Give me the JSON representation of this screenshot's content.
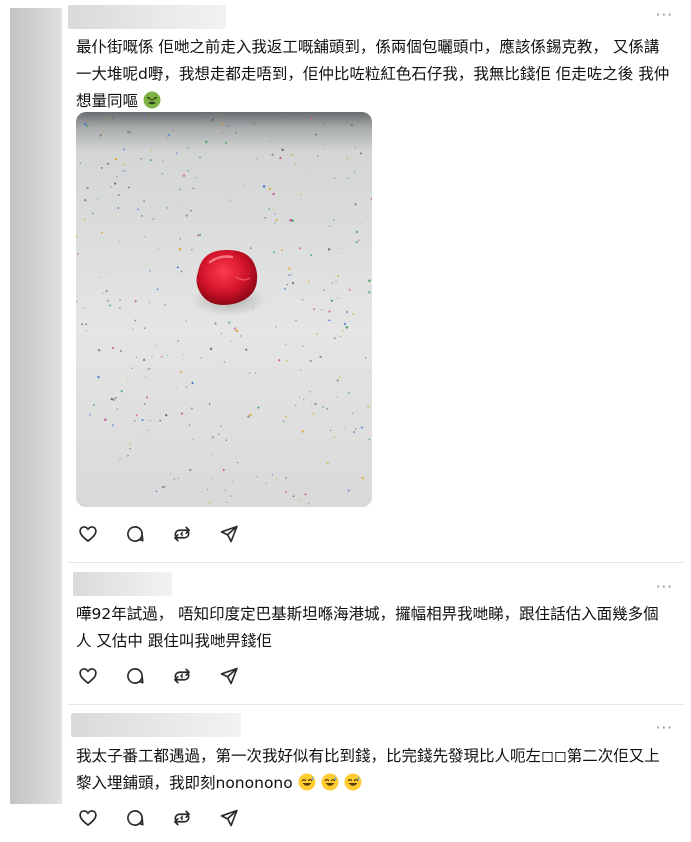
{
  "posts": [
    {
      "text": "最仆街嘅係 佢哋之前走入我返工嘅舖頭到，係兩個包曬頭巾，應該係錫克教， 又係講一大堆呢d嘢，我想走都走唔到，佢仲比咗粒紅色石仔我，我無比錢佢 佢走咗之後 我仲想量同嘔",
      "emoji": "nauseated-face"
    },
    {
      "text": "嘩92年試過， 唔知印度定巴基斯坦喺海港城，攞幅相畀我哋睇，跟住話估入面幾多個人 又估中 跟住叫我哋畀錢佢"
    },
    {
      "text": "我太子番工都遇過，第一次我好似有比到錢，比完錢先發現比人呃左◻◻第二次佢又上黎入埋鋪頭，我即刻nononono",
      "emoji": "grinning-sweat-face"
    }
  ],
  "more_label": "···",
  "icons": [
    "heart-icon",
    "comment-icon",
    "repost-icon",
    "share-icon"
  ],
  "colors": {
    "text": "#101010",
    "icon": "#2a2a2a",
    "divider": "#e7e7e7",
    "stone": "#d3142a"
  }
}
